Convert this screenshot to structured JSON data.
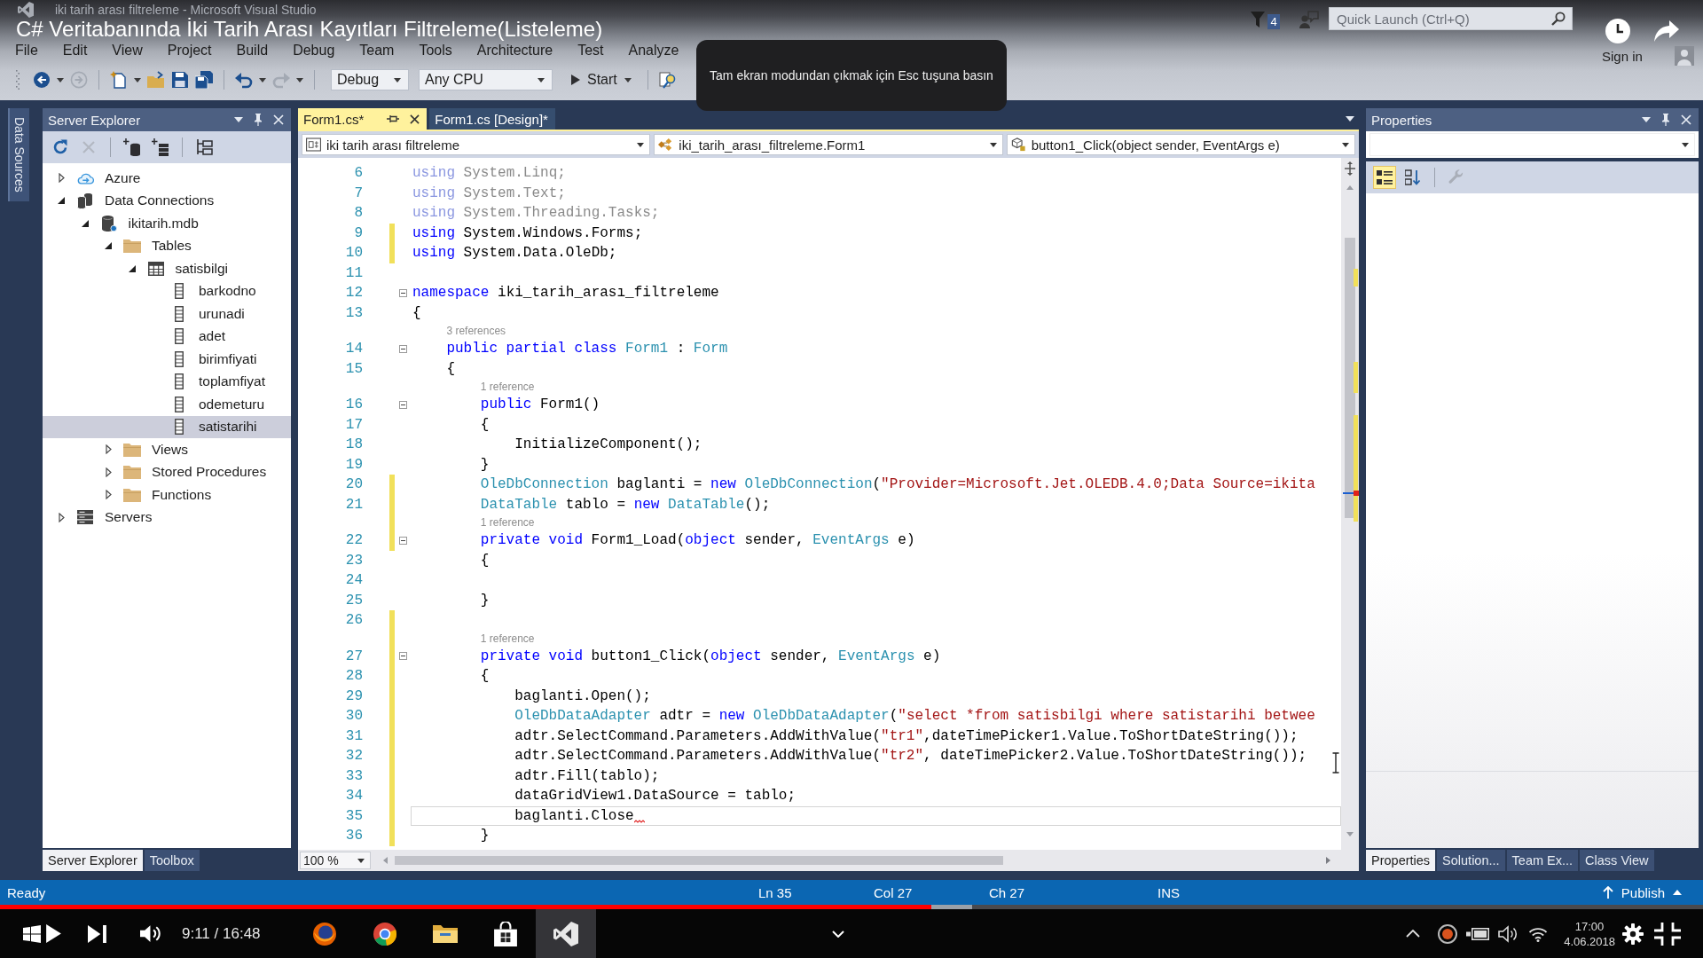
{
  "video": {
    "title": "C# Veritabanında İki Tarih Arası Kayıtları Filtreleme(Listeleme)",
    "fullscreen_hint": "Tam ekran modundan çıkmak için Esc tuşuna basın",
    "time": "9:11 / 16:48",
    "progress": {
      "level": 0.547
    },
    "buffer": {
      "level": 0.571
    }
  },
  "title_bar": {
    "window_title": "iki tarih arası filtreleme - Microsoft Visual Studio",
    "notification_count": "4",
    "quick_launch": {
      "placeholder": "Quick Launch (Ctrl+Q)"
    },
    "sign_in": "Sign in"
  },
  "menu": [
    "File",
    "Edit",
    "View",
    "Project",
    "Build",
    "Debug",
    "Team",
    "Tools",
    "Architecture",
    "Test",
    "Analyze"
  ],
  "toolbar": {
    "buttons": [
      {
        "kind": "back",
        "disabled": false
      },
      {
        "kind": "forward",
        "disabled": true
      },
      {
        "kind": "new_project",
        "disabled": false
      },
      {
        "kind": "open",
        "disabled": false
      },
      {
        "kind": "save",
        "disabled": false
      },
      {
        "kind": "save_all",
        "disabled": false
      },
      {
        "kind": "undo",
        "disabled": false
      },
      {
        "kind": "redo",
        "disabled": true
      }
    ],
    "configuration": "Debug",
    "platform": "Any CPU",
    "start": "Start"
  },
  "side_tabs": [
    "Data Sources"
  ],
  "server_explorer": {
    "title": "Server Explorer",
    "tools": [
      {
        "kind": "refresh",
        "disabled": false
      },
      {
        "kind": "delete",
        "disabled": true
      },
      {
        "kind": "connect_database",
        "disabled": false
      },
      {
        "kind": "connect_server",
        "disabled": false
      },
      {
        "kind": "hierarchy",
        "disabled": false
      }
    ],
    "tree": [
      {
        "label": "Azure",
        "kind": "cloud",
        "expanded": false,
        "selected": false
      },
      {
        "label": "Data Connections",
        "kind": "connections",
        "expanded": true,
        "selected": false,
        "children": [
          {
            "label": "ikitarih.mdb",
            "kind": "database",
            "expanded": true,
            "selected": false,
            "children": [
              {
                "label": "Tables",
                "kind": "folder",
                "expanded": true,
                "selected": false,
                "children": [
                  {
                    "label": "satisbilgi",
                    "kind": "table",
                    "expanded": true,
                    "selected": false,
                    "children": [
                      {
                        "label": "barkodno",
                        "kind": "column",
                        "selected": false
                      },
                      {
                        "label": "urunadi",
                        "kind": "column",
                        "selected": false
                      },
                      {
                        "label": "adet",
                        "kind": "column",
                        "selected": false
                      },
                      {
                        "label": "birimfiyati",
                        "kind": "column",
                        "selected": false
                      },
                      {
                        "label": "toplamfiyat",
                        "kind": "column",
                        "selected": false
                      },
                      {
                        "label": "odemeturu",
                        "kind": "column",
                        "selected": false
                      },
                      {
                        "label": "satistarihi",
                        "kind": "column",
                        "selected": true
                      }
                    ]
                  }
                ]
              },
              {
                "label": "Views",
                "kind": "folder",
                "expanded": false,
                "selected": false
              },
              {
                "label": "Stored Procedures",
                "kind": "folder",
                "expanded": false,
                "selected": false
              },
              {
                "label": "Functions",
                "kind": "folder",
                "expanded": false,
                "selected": false
              }
            ]
          }
        ]
      },
      {
        "label": "Servers",
        "kind": "servers",
        "expanded": false,
        "selected": false
      }
    ],
    "tabs": [
      {
        "label": "Server Explorer",
        "selected": true
      },
      {
        "label": "Toolbox",
        "selected": false
      }
    ]
  },
  "editor": {
    "tabs": [
      {
        "label": "Form1.cs*",
        "selected": true
      },
      {
        "label": "Form1.cs [Design]*",
        "selected": false
      }
    ],
    "nav": [
      {
        "kind": "project",
        "label": "iki tarih arası filtreleme"
      },
      {
        "kind": "class",
        "label": "iki_tarih_arası_filtreleme.Form1"
      },
      {
        "kind": "method",
        "label": "button1_Click(object sender, EventArgs e)"
      }
    ],
    "lines": [
      {
        "number": "6",
        "changed": false,
        "fold": false,
        "current": false,
        "error": false,
        "segments": [
          {
            "kind": "faded_keyword",
            "text": "using"
          },
          {
            "kind": "faded",
            "text": " System.Linq;"
          }
        ]
      },
      {
        "number": "7",
        "changed": false,
        "fold": false,
        "current": false,
        "error": false,
        "segments": [
          {
            "kind": "faded_keyword",
            "text": "using"
          },
          {
            "kind": "faded",
            "text": " System.Text;"
          }
        ]
      },
      {
        "number": "8",
        "changed": false,
        "fold": false,
        "current": false,
        "error": false,
        "segments": [
          {
            "kind": "faded_keyword",
            "text": "using"
          },
          {
            "kind": "faded",
            "text": " System.Threading.Tasks;"
          }
        ]
      },
      {
        "number": "9",
        "changed": true,
        "fold": false,
        "current": false,
        "error": false,
        "segments": [
          {
            "kind": "keyword",
            "text": "using"
          },
          {
            "kind": "plain",
            "text": " System.Windows.Forms;"
          }
        ]
      },
      {
        "number": "10",
        "changed": true,
        "fold": false,
        "current": false,
        "error": false,
        "segments": [
          {
            "kind": "keyword",
            "text": "using"
          },
          {
            "kind": "plain",
            "text": " System.Data.OleDb;"
          }
        ]
      },
      {
        "number": "11",
        "changed": false,
        "fold": false,
        "current": false,
        "error": false
      },
      {
        "number": "12",
        "changed": false,
        "fold": true,
        "current": false,
        "error": false,
        "segments": [
          {
            "kind": "keyword",
            "text": "namespace"
          },
          {
            "kind": "plain",
            "text": " iki_tarih_arası_filtreleme"
          }
        ]
      },
      {
        "number": "13",
        "changed": false,
        "fold": false,
        "current": false,
        "error": false,
        "segments": [
          {
            "kind": "plain",
            "text": "{"
          }
        ]
      },
      {
        "number": "14",
        "changed": false,
        "fold": true,
        "current": false,
        "error": false,
        "lens": "3 references",
        "segments": [
          {
            "kind": "keyword",
            "text": "    public partial class"
          },
          {
            "kind": "type",
            "text": " Form1"
          },
          {
            "kind": "plain",
            "text": " : "
          },
          {
            "kind": "type",
            "text": "Form"
          }
        ]
      },
      {
        "number": "15",
        "changed": false,
        "fold": false,
        "current": false,
        "error": false,
        "segments": [
          {
            "kind": "plain",
            "text": "    {"
          }
        ]
      },
      {
        "number": "16",
        "changed": false,
        "fold": true,
        "current": false,
        "error": false,
        "lens": "1 reference",
        "segments": [
          {
            "kind": "keyword",
            "text": "        public"
          },
          {
            "kind": "plain",
            "text": " Form1()"
          }
        ]
      },
      {
        "number": "17",
        "changed": false,
        "fold": false,
        "current": false,
        "error": false,
        "segments": [
          {
            "kind": "plain",
            "text": "        {"
          }
        ]
      },
      {
        "number": "18",
        "changed": false,
        "fold": false,
        "current": false,
        "error": false,
        "segments": [
          {
            "kind": "plain",
            "text": "            InitializeComponent();"
          }
        ]
      },
      {
        "number": "19",
        "changed": false,
        "fold": false,
        "current": false,
        "error": false,
        "segments": [
          {
            "kind": "plain",
            "text": "        }"
          }
        ]
      },
      {
        "number": "20",
        "changed": true,
        "fold": false,
        "current": false,
        "error": false,
        "segments": [
          {
            "kind": "type",
            "text": "        OleDbConnection"
          },
          {
            "kind": "plain",
            "text": " baglanti = "
          },
          {
            "kind": "keyword",
            "text": "new"
          },
          {
            "kind": "type",
            "text": " OleDbConnection"
          },
          {
            "kind": "plain",
            "text": "("
          },
          {
            "kind": "string",
            "text": "\"Provider=Microsoft.Jet.OLEDB.4.0;Data Source=ikita"
          }
        ]
      },
      {
        "number": "21",
        "changed": true,
        "fold": false,
        "current": false,
        "error": false,
        "segments": [
          {
            "kind": "type",
            "text": "        DataTable"
          },
          {
            "kind": "plain",
            "text": " tablo = "
          },
          {
            "kind": "keyword",
            "text": "new"
          },
          {
            "kind": "type",
            "text": " DataTable"
          },
          {
            "kind": "plain",
            "text": "();"
          }
        ]
      },
      {
        "number": "22",
        "changed": true,
        "fold": true,
        "current": false,
        "error": false,
        "lens": "1 reference",
        "segments": [
          {
            "kind": "keyword",
            "text": "        private void"
          },
          {
            "kind": "plain",
            "text": " Form1_Load("
          },
          {
            "kind": "keyword",
            "text": "object"
          },
          {
            "kind": "plain",
            "text": " sender, "
          },
          {
            "kind": "type",
            "text": "EventArgs"
          },
          {
            "kind": "plain",
            "text": " e)"
          }
        ]
      },
      {
        "number": "23",
        "changed": false,
        "fold": false,
        "current": false,
        "error": false,
        "segments": [
          {
            "kind": "plain",
            "text": "        {"
          }
        ]
      },
      {
        "number": "24",
        "changed": false,
        "fold": false,
        "current": false,
        "error": false
      },
      {
        "number": "25",
        "changed": false,
        "fold": false,
        "current": false,
        "error": false,
        "segments": [
          {
            "kind": "plain",
            "text": "        }"
          }
        ]
      },
      {
        "number": "26",
        "changed": true,
        "fold": false,
        "current": false,
        "error": false
      },
      {
        "number": "27",
        "changed": true,
        "fold": true,
        "current": false,
        "error": false,
        "lens": "1 reference",
        "segments": [
          {
            "kind": "keyword",
            "text": "        private void"
          },
          {
            "kind": "plain",
            "text": " button1_Click("
          },
          {
            "kind": "keyword",
            "text": "object"
          },
          {
            "kind": "plain",
            "text": " sender, "
          },
          {
            "kind": "type",
            "text": "EventArgs"
          },
          {
            "kind": "plain",
            "text": " e)"
          }
        ]
      },
      {
        "number": "28",
        "changed": true,
        "fold": false,
        "current": false,
        "error": false,
        "segments": [
          {
            "kind": "plain",
            "text": "        {"
          }
        ]
      },
      {
        "number": "29",
        "changed": true,
        "fold": false,
        "current": false,
        "error": false,
        "segments": [
          {
            "kind": "plain",
            "text": "            baglanti.Open();"
          }
        ]
      },
      {
        "number": "30",
        "changed": true,
        "fold": false,
        "current": false,
        "error": false,
        "segments": [
          {
            "kind": "type",
            "text": "            OleDbDataAdapter"
          },
          {
            "kind": "plain",
            "text": " adtr = "
          },
          {
            "kind": "keyword",
            "text": "new"
          },
          {
            "kind": "type",
            "text": " OleDbDataAdapter"
          },
          {
            "kind": "plain",
            "text": "("
          },
          {
            "kind": "string",
            "text": "\"select *from satisbilgi where satistarihi betwee"
          }
        ]
      },
      {
        "number": "31",
        "changed": true,
        "fold": false,
        "current": false,
        "error": false,
        "segments": [
          {
            "kind": "plain",
            "text": "            adtr.SelectCommand.Parameters.AddWithValue("
          },
          {
            "kind": "string",
            "text": "\"tr1\""
          },
          {
            "kind": "plain",
            "text": ",dateTimePicker1.Value.ToShortDateString());"
          }
        ]
      },
      {
        "number": "32",
        "changed": true,
        "fold": false,
        "current": false,
        "error": false,
        "segments": [
          {
            "kind": "plain",
            "text": "            adtr.SelectCommand.Parameters.AddWithValue("
          },
          {
            "kind": "string",
            "text": "\"tr2\""
          },
          {
            "kind": "plain",
            "text": ", dateTimePicker2.Value.ToShortDateString());"
          }
        ]
      },
      {
        "number": "33",
        "changed": true,
        "fold": false,
        "current": false,
        "error": false,
        "segments": [
          {
            "kind": "plain",
            "text": "            adtr.Fill(tablo);"
          }
        ]
      },
      {
        "number": "34",
        "changed": true,
        "fold": false,
        "current": false,
        "error": false,
        "segments": [
          {
            "kind": "plain",
            "text": "            dataGridView1.DataSource = tablo;"
          }
        ]
      },
      {
        "number": "35",
        "changed": true,
        "fold": false,
        "current": true,
        "error": true,
        "segments": [
          {
            "kind": "plain",
            "text": "            baglanti.Close"
          }
        ]
      },
      {
        "number": "36",
        "changed": true,
        "fold": false,
        "current": false,
        "error": false,
        "segments": [
          {
            "kind": "plain",
            "text": "        }"
          }
        ]
      }
    ],
    "zoom": "100 %"
  },
  "properties": {
    "title": "Properties",
    "tools": [
      {
        "kind": "categorized",
        "selected": true,
        "disabled": false
      },
      {
        "kind": "alphabetical",
        "selected": false,
        "disabled": false
      },
      {
        "kind": "property_pages",
        "selected": false,
        "disabled": true
      }
    ],
    "tabs": [
      {
        "label": "Properties",
        "selected": true
      },
      {
        "label": "Solution...",
        "selected": false
      },
      {
        "label": "Team Ex...",
        "selected": false
      },
      {
        "label": "Class View",
        "selected": false
      }
    ]
  },
  "status_bar": {
    "message": "Ready",
    "line": "Ln 35",
    "column": "Col 27",
    "char": "Ch 27",
    "mode": "INS",
    "publish": "Publish"
  },
  "taskbar": {
    "apps": [
      {
        "kind": "firefox",
        "selected": false
      },
      {
        "kind": "chrome",
        "selected": false
      },
      {
        "kind": "explorer",
        "selected": false
      },
      {
        "kind": "store",
        "selected": false
      },
      {
        "kind": "visual_studio",
        "selected": true
      }
    ],
    "time": "17:00",
    "date": "4.06.2018"
  }
}
